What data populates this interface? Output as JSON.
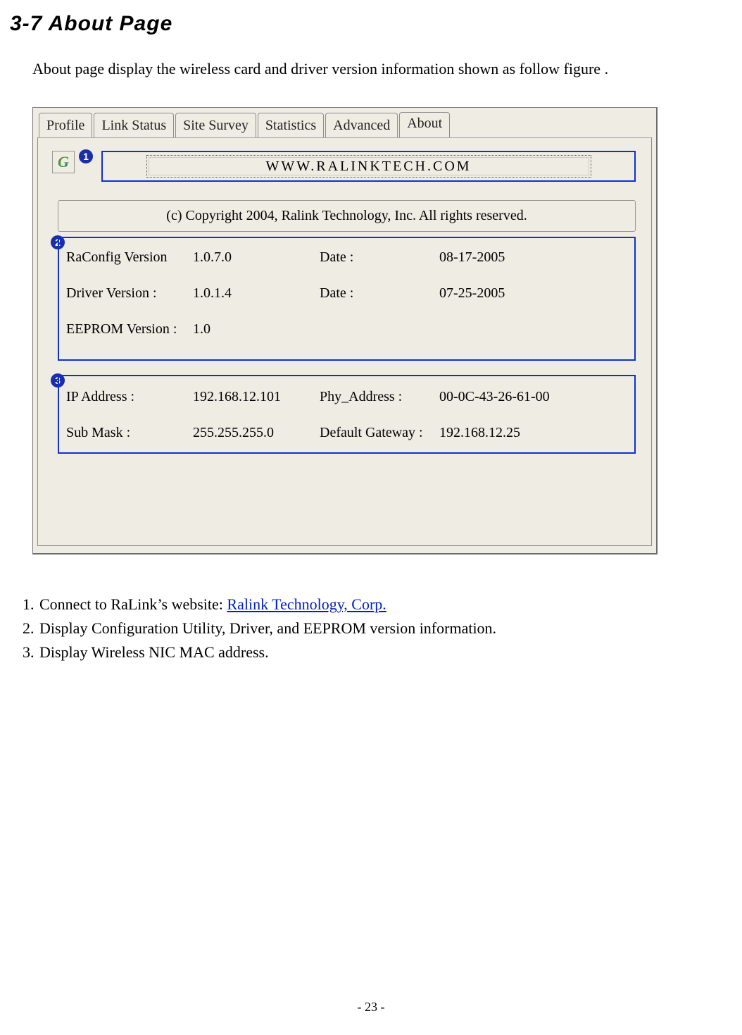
{
  "heading": "3-7   About Page",
  "intro": "About page display the wireless card and driver version information shown as follow figure .",
  "tabs": [
    "Profile",
    "Link Status",
    "Site Survey",
    "Statistics",
    "Advanced",
    "About"
  ],
  "active_tab_index": 5,
  "badges": {
    "n1": "1",
    "n2": "2",
    "n3": "3"
  },
  "logo_letter": "G",
  "website_button": "WWW.RALINKTECH.COM",
  "copyright": "(c) Copyright 2004, Ralink Technology, Inc.  All rights reserved.",
  "versions": {
    "row1": {
      "label": "RaConfig Version",
      "value": "1.0.7.0",
      "date_label": "Date :",
      "date": "08-17-2005"
    },
    "row2": {
      "label": "Driver Version :",
      "value": "1.0.1.4",
      "date_label": "Date :",
      "date": "07-25-2005"
    },
    "row3": {
      "label": "EEPROM Version :",
      "value": "1.0"
    }
  },
  "network": {
    "row1": {
      "l1": "IP Address :",
      "v1": "192.168.12.101",
      "l2": "Phy_Address :",
      "v2": "00-0C-43-26-61-00"
    },
    "row2": {
      "l1": "Sub Mask :",
      "v1": "255.255.255.0",
      "l2": "Default Gateway :",
      "v2": "192.168.12.25"
    }
  },
  "list": {
    "item1_prefix": "Connect to RaLink’s website: ",
    "item1_link": "Ralink Technology, Corp.",
    "item2": "Display Configuration Utility, Driver, and EEPROM version information.",
    "item3": "Display Wireless NIC MAC address."
  },
  "page_footer": "- 23 -"
}
